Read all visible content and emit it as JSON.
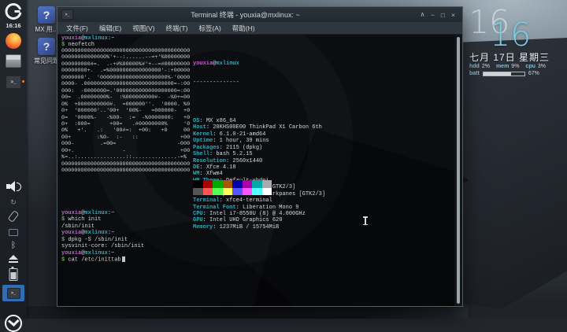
{
  "colors": {
    "accent_blue": "#2f6db5",
    "prompt_user_magenta": "#c061cb",
    "prompt_host_cyan": "#35a9b7",
    "prompt_green": "#54b33e",
    "clock_cyan": "#7dcbe6",
    "terminal_bg": "#0b0d10"
  },
  "desktop": {
    "icons": [
      {
        "glyph": "?",
        "label": "MX 用..."
      },
      {
        "glyph": "?",
        "label": "常见问题"
      }
    ]
  },
  "dock": {
    "time": "16:16",
    "terminal_glyph": ">_",
    "items": [
      "app-menu",
      "clock",
      "firefox",
      "file-manager",
      "terminal-launcher",
      "volume",
      "updates",
      "clipboard",
      "display",
      "bluetooth",
      "eject",
      "battery",
      "active-terminal-task",
      "mx-menu"
    ]
  },
  "terminal": {
    "title": "Terminal 终端 - youxia@mxlinux: ~",
    "menu": [
      "文件(F)",
      "编辑(E)",
      "视图(V)",
      "终端(T)",
      "标签(A)",
      "帮助(H)"
    ],
    "window_buttons": [
      {
        "name": "shade",
        "glyph": "∧"
      },
      {
        "name": "minimize",
        "glyph": "−"
      },
      {
        "name": "maximize",
        "glyph": "□"
      },
      {
        "name": "close",
        "glyph": "×"
      }
    ],
    "prompt": {
      "user": "youxia",
      "at": "@",
      "host": "mxlinux",
      "path": ":~",
      "symbol": "$"
    },
    "top_lines": [
      {
        "kind": "prompt"
      },
      {
        "kind": "cmd",
        "text": "neofetch"
      }
    ],
    "bottom_lines": [
      {
        "kind": "prompt"
      },
      {
        "kind": "cmd",
        "text": "which init"
      },
      {
        "kind": "out",
        "text": "/sbin/init"
      },
      {
        "kind": "prompt"
      },
      {
        "kind": "cmd",
        "text": "dpkg -S /sbin/init"
      },
      {
        "kind": "out",
        "text": "sysvinit-core: /sbin/init"
      },
      {
        "kind": "prompt"
      },
      {
        "kind": "cmd",
        "text": "cat /etc/inittab",
        "cursor": true
      }
    ],
    "neofetch": {
      "ascii_art": [
        "0000000000000000000000000000000000000000",
        "00000000000000%'+--:......--=+'%00000000",
        "000000000#=.  .-+#%00000%#'+--=#00000000",
        "00000000+.  .=%0000000000000000'-:+00000",
        "0000000'.  '000000000000000000000%-'0000",
        "0000- .0000000000000000000000000000=-:00",
        "000:  -0000000=.'0000000000000000000=:00",
        "00=  .00000000%-  :%000000000#-  -%0+=00",
        "0%  +0000000000#.  =000000''.  '0000. %0",
        "0+  '000000'..'00+  '00%-   =000000-  +0",
        "0=  '0000%-   -%00-  :=  -%0000000:   +0",
        "0+  :000=      +00=   .#00000000%     '0",
        "0%   +'.   .:   '00#=:  +00:   +0     00",
        "00+        :%0-  :-   ::             +00",
        "000-        .=00=                   -000",
        "00+.               -                 +00",
        "%=..:...............::..............-=%",
        "0000000000000000000000000000000000000000",
        "0000000000000000000000000000000000000000"
      ],
      "separator": "--------------",
      "info": [
        {
          "label": "OS",
          "value": "MX x86_64"
        },
        {
          "label": "Host",
          "value": "20KHS00E00 ThinkPad X1 Carbon 6th"
        },
        {
          "label": "Kernel",
          "value": "6.1.0-21-amd64"
        },
        {
          "label": "Uptime",
          "value": "1 hour, 39 mins"
        },
        {
          "label": "Packages",
          "value": "2115 (dpkg)"
        },
        {
          "label": "Shell",
          "value": "bash 5.2.15"
        },
        {
          "label": "Resolution",
          "value": "2560x1440"
        },
        {
          "label": "DE",
          "value": "Xfce 4.18"
        },
        {
          "label": "WM",
          "value": "Xfwm4"
        },
        {
          "label": "WM Theme",
          "value": "Default-xhdpi"
        },
        {
          "label": "Theme",
          "value": "mx-comfort-dark [GTK2/3]"
        },
        {
          "label": "Icons",
          "value": "Papirus-mxblue-darkpanes [GTK2/3]"
        },
        {
          "label": "Terminal",
          "value": "xfce4-terminal"
        },
        {
          "label": "Terminal Font",
          "value": "Liberation Mono 9"
        },
        {
          "label": "CPU",
          "value": "Intel i7-8550U (8) @ 4.000GHz"
        },
        {
          "label": "GPU",
          "value": "Intel UHD Graphics 620"
        },
        {
          "label": "Memory",
          "value": "1237MiB / 15754MiB"
        }
      ],
      "palette_row1": [
        "#000000",
        "#aa0000",
        "#00aa00",
        "#aa5500",
        "#0000aa",
        "#aa00aa",
        "#00aaaa",
        "#aaaaaa"
      ],
      "palette_row2": [
        "#555555",
        "#ff5555",
        "#55ff55",
        "#ffff55",
        "#5555ff",
        "#ff55ff",
        "#55ffff",
        "#ffffff"
      ]
    }
  },
  "clock": {
    "hour": "16",
    "minute": "16",
    "date": "七月 17日 星期三",
    "stats": [
      {
        "label": "hdd",
        "value": "2%"
      },
      {
        "label": "mem",
        "value": "9%"
      },
      {
        "label": "cpu",
        "value": "3%"
      }
    ],
    "battery": {
      "label": "batt",
      "value": "67%",
      "percent": 67
    }
  }
}
